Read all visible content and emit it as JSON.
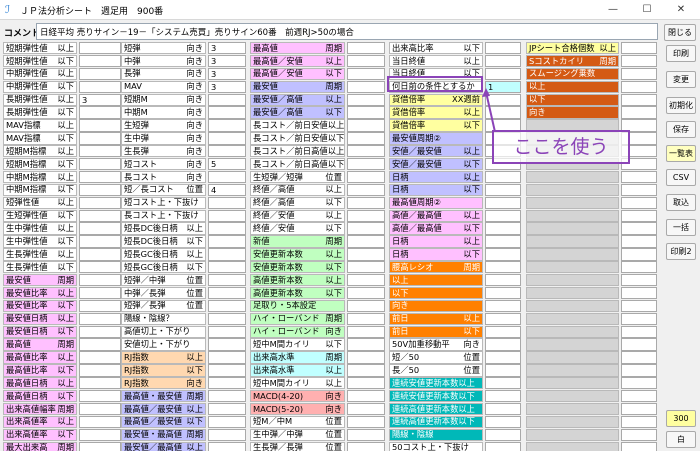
{
  "window": {
    "title": "ＪＰ法分析シート　週足用　900番",
    "minimize_label": "—",
    "maximize_label": "☐",
    "close_label": "✕"
  },
  "comment": {
    "label": "コメント",
    "value": "日経平均 売りサイン－19－「システム売買」売りサイン60番　前週RJ>50の場合"
  },
  "colors": {
    "white": "#ffffff",
    "gray": "#d4d4d4",
    "pink": "#ffc0ff",
    "lavender": "#c0c0ff",
    "green": "#c0ffc0",
    "cyan": "#c0ffff",
    "yellow": "#ffffa0",
    "peach": "#ffd8b0",
    "salmon": "#ffb0b0",
    "orange": "#ff8000",
    "teal": "#00b8b8",
    "brown": "#d45a14",
    "accent": "#8b44b8"
  },
  "columns": [
    [
      {
        "label": "短期弾性値",
        "cond": "以上",
        "bg": "white"
      },
      {
        "label": "短期弾性値",
        "cond": "以下",
        "bg": "white"
      },
      {
        "label": "中期弾性値",
        "cond": "以上",
        "bg": "white"
      },
      {
        "label": "中期弾性値",
        "cond": "以下",
        "bg": "white"
      },
      {
        "label": "長期弾性値",
        "cond": "以上",
        "bg": "white",
        "value": "3"
      },
      {
        "label": "長期弾性値",
        "cond": "以下",
        "bg": "white"
      },
      {
        "label": "MAV指標",
        "cond": "以上",
        "bg": "white"
      },
      {
        "label": "MAV指標",
        "cond": "以下",
        "bg": "white"
      },
      {
        "label": "短期M指標",
        "cond": "以上",
        "bg": "white"
      },
      {
        "label": "短期M指標",
        "cond": "以下",
        "bg": "white"
      },
      {
        "label": "中期M指標",
        "cond": "以上",
        "bg": "white"
      },
      {
        "label": "中期M指標",
        "cond": "以下",
        "bg": "white"
      },
      {
        "label": "短弾性値",
        "cond": "以上",
        "bg": "white"
      },
      {
        "label": "生短弾性値",
        "cond": "以下",
        "bg": "white"
      },
      {
        "label": "生中弾性値",
        "cond": "以上",
        "bg": "white"
      },
      {
        "label": "生中弾性値",
        "cond": "以下",
        "bg": "white"
      },
      {
        "label": "生長弾性値",
        "cond": "以上",
        "bg": "white"
      },
      {
        "label": "生長弾性値",
        "cond": "以下",
        "bg": "white"
      },
      {
        "label": "最安値",
        "cond": "周期",
        "bg": "pink"
      },
      {
        "label": "最安値比率",
        "cond": "以上",
        "bg": "pink"
      },
      {
        "label": "最安値比率",
        "cond": "以下",
        "bg": "pink"
      },
      {
        "label": "最安値日柄",
        "cond": "以上",
        "bg": "pink"
      },
      {
        "label": "最安値日柄",
        "cond": "以下",
        "bg": "pink"
      },
      {
        "label": "最高値",
        "cond": "周期",
        "bg": "pink"
      },
      {
        "label": "最高値比率",
        "cond": "以上",
        "bg": "pink"
      },
      {
        "label": "最高値比率",
        "cond": "以下",
        "bg": "pink"
      },
      {
        "label": "最高値日柄",
        "cond": "以上",
        "bg": "pink"
      },
      {
        "label": "最高値日柄",
        "cond": "以下",
        "bg": "pink"
      },
      {
        "label": "出来高値幅率",
        "cond": "周期",
        "bg": "pink"
      },
      {
        "label": "出来高値率",
        "cond": "以上",
        "bg": "pink"
      },
      {
        "label": "出来高値率",
        "cond": "以下",
        "bg": "pink"
      },
      {
        "label": "最大出来高",
        "cond": "周期",
        "bg": "pink"
      },
      {
        "label": "最大出来高か？",
        "cond": "",
        "bg": "pink"
      }
    ],
    [
      {
        "label": "短弾",
        "cond": "向き",
        "bg": "white",
        "value": "3"
      },
      {
        "label": "中弾",
        "cond": "向き",
        "bg": "white",
        "value": "3"
      },
      {
        "label": "長弾",
        "cond": "向き",
        "bg": "white",
        "value": "3"
      },
      {
        "label": "MAV",
        "cond": "向き",
        "bg": "white",
        "value": "3"
      },
      {
        "label": "短期M",
        "cond": "向き",
        "bg": "white"
      },
      {
        "label": "中期M",
        "cond": "向き",
        "bg": "white"
      },
      {
        "label": "生短弾",
        "cond": "向き",
        "bg": "white"
      },
      {
        "label": "生中弾",
        "cond": "向き",
        "bg": "white"
      },
      {
        "label": "生長弾",
        "cond": "向き",
        "bg": "white"
      },
      {
        "label": "短コスト",
        "cond": "向き",
        "bg": "white",
        "value": "5"
      },
      {
        "label": "長コスト",
        "cond": "向き",
        "bg": "white"
      },
      {
        "label": "短／長コスト",
        "cond": "位置",
        "bg": "white",
        "value": "4"
      },
      {
        "label": "短コスト上・下抜け",
        "cond": "",
        "bg": "white"
      },
      {
        "label": "長コスト上・下抜け",
        "cond": "",
        "bg": "white"
      },
      {
        "label": "短長DC後日柄",
        "cond": "以上",
        "bg": "white"
      },
      {
        "label": "短長DC後日柄",
        "cond": "以下",
        "bg": "white"
      },
      {
        "label": "短長GC後日柄",
        "cond": "以上",
        "bg": "white"
      },
      {
        "label": "短長GC後日柄",
        "cond": "以下",
        "bg": "white"
      },
      {
        "label": "短弾／中弾",
        "cond": "位置",
        "bg": "white"
      },
      {
        "label": "中弾／長弾",
        "cond": "位置",
        "bg": "white"
      },
      {
        "label": "短弾／長弾",
        "cond": "位置",
        "bg": "white"
      },
      {
        "label": "陽線・陰線？",
        "cond": "",
        "bg": "white"
      },
      {
        "label": "高値切上・下がり",
        "cond": "",
        "bg": "white"
      },
      {
        "label": "安値切上・下がり",
        "cond": "",
        "bg": "white"
      },
      {
        "label": "RJ指数",
        "cond": "以上",
        "bg": "peach"
      },
      {
        "label": "RJ指数",
        "cond": "以下",
        "bg": "peach"
      },
      {
        "label": "RJ指数",
        "cond": "向き",
        "bg": "peach"
      },
      {
        "label": "最高値・最安値",
        "cond": "周期",
        "bg": "lavender"
      },
      {
        "label": "最高値／最安値",
        "cond": "以上",
        "bg": "lavender"
      },
      {
        "label": "最高値／最安値",
        "cond": "以下",
        "bg": "lavender"
      },
      {
        "label": "最安値・最高値",
        "cond": "周期",
        "bg": "lavender"
      },
      {
        "label": "最安値／最高値",
        "cond": "以上",
        "bg": "lavender"
      },
      {
        "label": "最安値／最高値",
        "cond": "以下",
        "bg": "lavender"
      }
    ],
    [
      {
        "label": "最高値",
        "cond": "周期",
        "bg": "pink"
      },
      {
        "label": "最高値／安値",
        "cond": "以上",
        "bg": "pink"
      },
      {
        "label": "最高値／安値",
        "cond": "以下",
        "bg": "pink"
      },
      {
        "label": "最安値",
        "cond": "周期",
        "bg": "lavender"
      },
      {
        "label": "最安値／高値",
        "cond": "以上",
        "bg": "lavender"
      },
      {
        "label": "最安値／高値",
        "cond": "以下",
        "bg": "lavender"
      },
      {
        "label": "長コスト／前日安値",
        "cond": "以上",
        "bg": "white"
      },
      {
        "label": "長コスト／前日安値",
        "cond": "以下",
        "bg": "white"
      },
      {
        "label": "長コスト／前日高値",
        "cond": "以上",
        "bg": "white"
      },
      {
        "label": "長コスト／前日高値",
        "cond": "以下",
        "bg": "white"
      },
      {
        "label": "生短弾／短弾",
        "cond": "位置",
        "bg": "white"
      },
      {
        "label": "終値／高値",
        "cond": "以上",
        "bg": "white"
      },
      {
        "label": "終値／高値",
        "cond": "以下",
        "bg": "white"
      },
      {
        "label": "終値／安値",
        "cond": "以上",
        "bg": "white"
      },
      {
        "label": "終値／安値",
        "cond": "以下",
        "bg": "white"
      },
      {
        "label": "新値",
        "cond": "周期",
        "bg": "green"
      },
      {
        "label": "安値更新本数",
        "cond": "以上",
        "bg": "green"
      },
      {
        "label": "安値更新本数",
        "cond": "以下",
        "bg": "green"
      },
      {
        "label": "高値更新本数",
        "cond": "以上",
        "bg": "green"
      },
      {
        "label": "高値更新本数",
        "cond": "以下",
        "bg": "green"
      },
      {
        "label": "足取り・5本設定",
        "cond": "",
        "bg": "green"
      },
      {
        "label": "ハイ・ローバンド",
        "cond": "周期",
        "bg": "green"
      },
      {
        "label": "ハイ・ローバンド",
        "cond": "向き",
        "bg": "green"
      },
      {
        "label": "短中M間カイリ",
        "cond": "以下",
        "bg": "white"
      },
      {
        "label": "出来高水準",
        "cond": "周期",
        "bg": "cyan"
      },
      {
        "label": "出来高水準",
        "cond": "以上",
        "bg": "cyan"
      },
      {
        "label": "短中M間カイリ",
        "cond": "以上",
        "bg": "white"
      },
      {
        "label": "MACD(4-20)",
        "cond": "向き",
        "bg": "salmon"
      },
      {
        "label": "MACD(5-20)",
        "cond": "向き",
        "bg": "salmon"
      },
      {
        "label": "短M／中M",
        "cond": "位置",
        "bg": "white"
      },
      {
        "label": "生中弾／中弾",
        "cond": "位置",
        "bg": "white"
      },
      {
        "label": "生長弾／長弾",
        "cond": "位置",
        "bg": "white"
      },
      {
        "label": "出来高比率",
        "cond": "以上",
        "bg": "white"
      }
    ],
    [
      {
        "label": "出来高比率",
        "cond": "以下",
        "bg": "white"
      },
      {
        "label": "当日終値",
        "cond": "以上",
        "bg": "white"
      },
      {
        "label": "当日終値",
        "cond": "以下",
        "bg": "white"
      },
      {
        "label": "何日前の条件とするか",
        "cond": "",
        "bg": "white",
        "value": "1",
        "vbg": "cyan"
      },
      {
        "label": "貸借倍率",
        "cond": "XX週前",
        "bg": "yellow"
      },
      {
        "label": "貸借倍率",
        "cond": "以上",
        "bg": "yellow"
      },
      {
        "label": "貸借倍率",
        "cond": "以下",
        "bg": "yellow"
      },
      {
        "label": "最安値周期②",
        "cond": "",
        "bg": "lavender"
      },
      {
        "label": "安値／最安値",
        "cond": "以上",
        "bg": "lavender"
      },
      {
        "label": "安値／最安値",
        "cond": "以下",
        "bg": "lavender"
      },
      {
        "label": "日柄",
        "cond": "以上",
        "bg": "lavender"
      },
      {
        "label": "日柄",
        "cond": "以下",
        "bg": "lavender"
      },
      {
        "label": "最高値周期②",
        "cond": "",
        "bg": "pink"
      },
      {
        "label": "高値／最高値",
        "cond": "以上",
        "bg": "pink"
      },
      {
        "label": "高値／最高値",
        "cond": "以下",
        "bg": "pink"
      },
      {
        "label": "日柄",
        "cond": "以上",
        "bg": "pink"
      },
      {
        "label": "日柄",
        "cond": "以下",
        "bg": "pink"
      },
      {
        "label": "腰高レシオ",
        "cond": "周期",
        "bg": "orange"
      },
      {
        "label": "以上",
        "cond": "",
        "bg": "orange"
      },
      {
        "label": "以下",
        "cond": "",
        "bg": "orange"
      },
      {
        "label": "向き",
        "cond": "",
        "bg": "orange"
      },
      {
        "label": "前日",
        "cond": "以上",
        "bg": "orange"
      },
      {
        "label": "前日",
        "cond": "以下",
        "bg": "orange"
      },
      {
        "label": "50V加重移動平",
        "cond": "向き",
        "bg": "white"
      },
      {
        "label": "短／50",
        "cond": "位置",
        "bg": "white"
      },
      {
        "label": "長／50",
        "cond": "位置",
        "bg": "white"
      },
      {
        "label": "連続安値更新本数以上",
        "cond": "",
        "bg": "teal"
      },
      {
        "label": "連続安値更新本数以下",
        "cond": "",
        "bg": "teal"
      },
      {
        "label": "連続高値更新本数以上",
        "cond": "",
        "bg": "teal"
      },
      {
        "label": "連続高値更新本数以下",
        "cond": "",
        "bg": "teal"
      },
      {
        "label": "陽線・陰線",
        "cond": "",
        "bg": "teal"
      },
      {
        "label": "50コスト上・下抜け",
        "cond": "",
        "bg": "white"
      },
      {
        "label": "JPシート番号",
        "cond": "",
        "bg": "yellow"
      }
    ],
    [
      {
        "label": "JPシート合格個数",
        "cond": "以上",
        "bg": "yellow"
      },
      {
        "label": "Sコストカイリ",
        "cond": "周期",
        "bg": "brown"
      },
      {
        "label": "スムージング乗数",
        "cond": "",
        "bg": "brown"
      },
      {
        "label": "以上",
        "cond": "",
        "bg": "brown"
      },
      {
        "label": "以下",
        "cond": "",
        "bg": "brown"
      },
      {
        "label": "向き",
        "cond": "",
        "bg": "brown"
      },
      {
        "label": "",
        "cond": "",
        "bg": "gray"
      },
      {
        "label": "",
        "cond": "",
        "bg": "gray"
      },
      {
        "label": "",
        "cond": "",
        "bg": "gray"
      },
      {
        "label": "",
        "cond": "",
        "bg": "gray"
      },
      {
        "label": "",
        "cond": "",
        "bg": "gray"
      },
      {
        "label": "",
        "cond": "",
        "bg": "gray"
      },
      {
        "label": "",
        "cond": "",
        "bg": "gray"
      },
      {
        "label": "",
        "cond": "",
        "bg": "gray"
      },
      {
        "label": "",
        "cond": "",
        "bg": "gray"
      },
      {
        "label": "",
        "cond": "",
        "bg": "gray"
      },
      {
        "label": "",
        "cond": "",
        "bg": "gray"
      },
      {
        "label": "",
        "cond": "",
        "bg": "gray"
      },
      {
        "label": "",
        "cond": "",
        "bg": "gray"
      },
      {
        "label": "",
        "cond": "",
        "bg": "gray"
      },
      {
        "label": "",
        "cond": "",
        "bg": "gray"
      },
      {
        "label": "",
        "cond": "",
        "bg": "gray"
      },
      {
        "label": "",
        "cond": "",
        "bg": "gray"
      },
      {
        "label": "",
        "cond": "",
        "bg": "gray"
      },
      {
        "label": "",
        "cond": "",
        "bg": "gray"
      },
      {
        "label": "",
        "cond": "",
        "bg": "gray"
      },
      {
        "label": "",
        "cond": "",
        "bg": "gray"
      },
      {
        "label": "",
        "cond": "",
        "bg": "gray"
      },
      {
        "label": "",
        "cond": "",
        "bg": "gray"
      },
      {
        "label": "",
        "cond": "",
        "bg": "gray"
      },
      {
        "label": "",
        "cond": "",
        "bg": "gray"
      },
      {
        "label": "",
        "cond": "",
        "bg": "gray"
      },
      {
        "label": "",
        "cond": "",
        "bg": "gray"
      }
    ]
  ],
  "side_buttons": {
    "close": "閉じる",
    "print": "印刷",
    "change": "変更",
    "initialize": "初期化",
    "save": "保存",
    "list": "一覧表",
    "csv": "CSV",
    "import": "取込",
    "batch": "一括",
    "print2": "印刷2",
    "number": "300",
    "white": "白"
  },
  "annotation": {
    "callout_text": "ここを使う"
  }
}
